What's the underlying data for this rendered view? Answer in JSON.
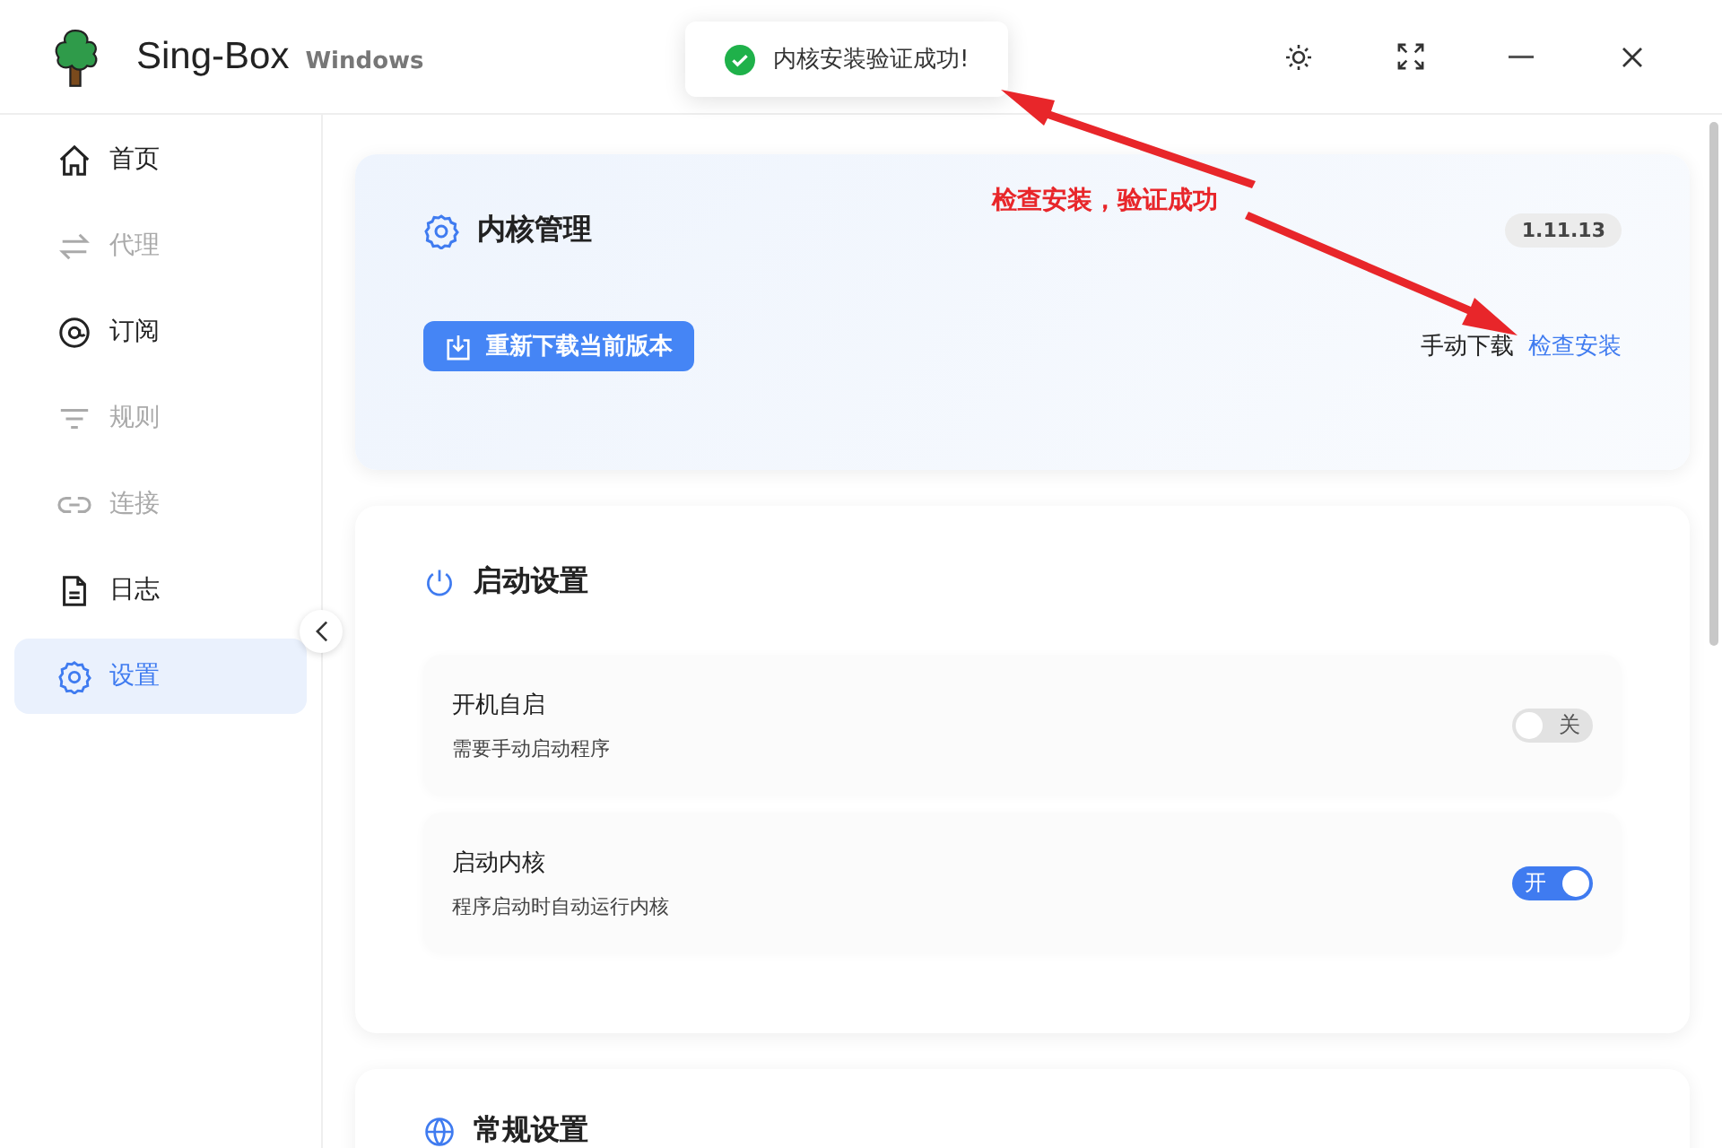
{
  "app": {
    "title": "Sing-Box",
    "platform": "Windows"
  },
  "toast": {
    "message": "内核安装验证成功!"
  },
  "sidebar": {
    "items": [
      {
        "label": "首页",
        "disabled": false,
        "selected": false
      },
      {
        "label": "代理",
        "disabled": true,
        "selected": false
      },
      {
        "label": "订阅",
        "disabled": false,
        "selected": false
      },
      {
        "label": "规则",
        "disabled": true,
        "selected": false
      },
      {
        "label": "连接",
        "disabled": true,
        "selected": false
      },
      {
        "label": "日志",
        "disabled": false,
        "selected": false
      },
      {
        "label": "设置",
        "disabled": false,
        "selected": true
      }
    ]
  },
  "kernel_card": {
    "title": "内核管理",
    "version": "1.11.13",
    "redownload_button": "重新下载当前版本",
    "manual_download": "手动下载",
    "check_install_link": "检查安装"
  },
  "startup_card": {
    "title": "启动设置",
    "settings": [
      {
        "label": "开机自启",
        "description": "需要手动启动程序",
        "on": false,
        "switch_text": "关"
      },
      {
        "label": "启动内核",
        "description": "程序启动时自动运行内核",
        "on": true,
        "switch_text": "开"
      }
    ]
  },
  "general_card": {
    "title": "常规设置"
  },
  "annotation": {
    "text": "检查安装，验证成功"
  }
}
